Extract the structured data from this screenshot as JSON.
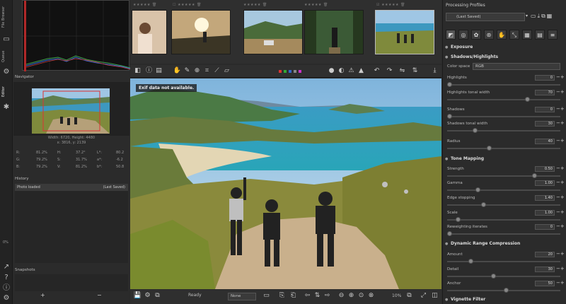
{
  "left_tabs": {
    "file_browser": "File Browser",
    "queue": "Queue",
    "editor": "Editor"
  },
  "navigator": {
    "title": "Navigator",
    "size_line": "Width: 6720, Height: 4480",
    "coords": "x: 3816, y: 2139",
    "r_label": "R:",
    "r_val": "81.2%",
    "g_label": "G:",
    "g_val": "79.2%",
    "b_label": "B:",
    "b_val": "79.2%",
    "h_label": "H:",
    "h_val": "37.2°",
    "s_label": "S:",
    "s_val": "31.7%",
    "v_label": "V:",
    "v_val": "81.2%",
    "l_label": "L*:",
    "l_val": "80.2",
    "a_label": "a*:",
    "a_val": "-6.2",
    "bb_label": "b*:",
    "bb_val": "50.8"
  },
  "history": {
    "title": "History",
    "col1": "Photo loaded",
    "col2": "(Last Saved)"
  },
  "snapshots": {
    "title": "Snapshots",
    "add": "+",
    "remove": "−"
  },
  "left_percent": "0%",
  "exif_notice": "Exif data not available.",
  "bottom_bar": {
    "status": "Ready",
    "color_mode": "None",
    "zoom": "10%"
  },
  "processing_profiles": {
    "title": "Processing Profiles",
    "selected": "(Last Saved)"
  },
  "exposure": {
    "title": "Exposure"
  },
  "shadows_highlights": {
    "title": "Shadows/Highlights",
    "color_space_label": "Color space",
    "color_space_value": "RGB",
    "highlights_label": "Highlights",
    "highlights_val": "0",
    "tonal_width_label": "Highlights tonal width",
    "tonal_width_val": "70",
    "shadows_label": "Shadows",
    "shadows_val": "0",
    "shadows_tw_label": "Shadows tonal width",
    "shadows_tw_val": "30",
    "radius_label": "Radius",
    "radius_val": "40"
  },
  "tone_mapping": {
    "title": "Tone Mapping",
    "strength_label": "Strength",
    "strength_val": "0.50",
    "gamma_label": "Gamma",
    "gamma_val": "1.00",
    "edge_label": "Edge stopping",
    "edge_val": "1.40",
    "scale_label": "Scale",
    "scale_val": "1.00",
    "reweight_label": "Reweighting iterates",
    "reweight_val": "0"
  },
  "drc": {
    "title": "Dynamic Range Compression",
    "amount_label": "Amount",
    "amount_val": "20",
    "detail_label": "Detail",
    "detail_val": "30",
    "anchor_label": "Anchor",
    "anchor_val": "50"
  },
  "vignette": {
    "title": "Vignette Filter"
  },
  "colors": {
    "accent": "#4a90d9",
    "panel": "#2b2b2b",
    "dark": "#1c1c1c"
  }
}
